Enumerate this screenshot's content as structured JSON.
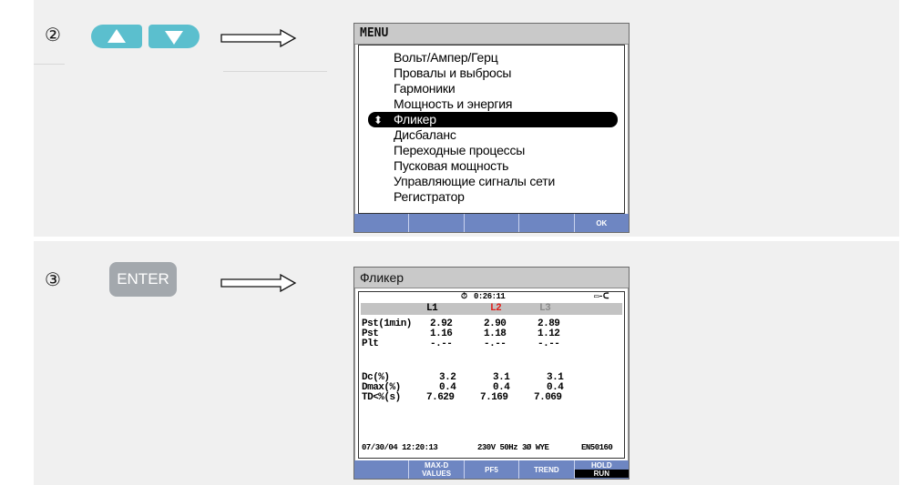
{
  "step2": {
    "number": "②",
    "menu_screen": {
      "title": "MENU",
      "items": [
        "Вольт/Ампер/Герц",
        "Провалы и выбросы",
        "Гармоники",
        "Мощность и энергия",
        "Фликер",
        "Дисбаланс",
        "Переходные процессы",
        "Пусковая мощность",
        "Управляющие сигналы сети",
        "Регистратор"
      ],
      "selected_index": 4,
      "selector_glyph": "⬍",
      "fkeys": [
        "",
        "",
        "",
        "",
        "OK"
      ]
    }
  },
  "step3": {
    "number": "③",
    "enter_label": "ENTER",
    "flicker_screen": {
      "title": "Фликер",
      "timer": "0:26:11",
      "phases": [
        "L1",
        "L2",
        "L3"
      ],
      "phase_colors": [
        "#000000",
        "#e0201c",
        "#8a8a8a"
      ],
      "rows": [
        {
          "label": "Pst(1min)",
          "values": [
            "2.92",
            "2.90",
            "2.89"
          ]
        },
        {
          "label": "Pst",
          "values": [
            "1.16",
            "1.18",
            "1.12"
          ]
        },
        {
          "label": "Plt",
          "values": [
            "-.--",
            "-.--",
            "-.--"
          ]
        },
        {
          "label": "Dc(%)",
          "values": [
            "3.2",
            "3.1",
            "3.1"
          ]
        },
        {
          "label": "Dmax(%)",
          "values": [
            "0.4",
            "0.4",
            "0.4"
          ]
        },
        {
          "label": "TD<%(s)",
          "values": [
            "7.629",
            "7.169",
            "7.069"
          ]
        }
      ],
      "status": {
        "datetime": "07/30/04  12:20:13",
        "config": "230V  50Hz 3Ø WYE",
        "standard": "EN50160"
      },
      "fkeys": [
        {
          "line1": "",
          "line2": ""
        },
        {
          "line1": "MAX-D",
          "line2": "VALUES"
        },
        {
          "line1": "PF5",
          "line2": ""
        },
        {
          "line1": "TREND",
          "line2": ""
        },
        {
          "line1": "HOLD",
          "line2": "RUN"
        }
      ]
    }
  },
  "colors": {
    "arrow_button": "#5bbfce",
    "enter_button": "#a3a8ad",
    "fkey_bar": "#6e86c2",
    "title_bar": "#c9c9c9",
    "row_background": "#f0f0f0"
  }
}
